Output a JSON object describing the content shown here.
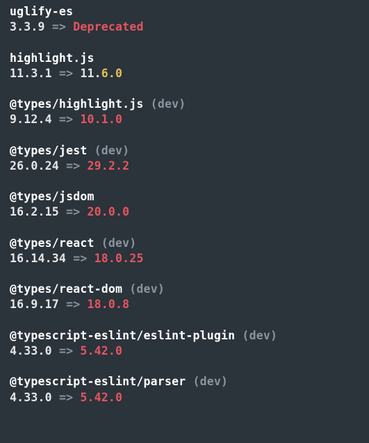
{
  "arrow": "=>",
  "dev_suffix": " (dev)",
  "packages": [
    {
      "name": "uglify-es",
      "dev": false,
      "current": "3.3.9",
      "deprecated": true
    },
    {
      "name": "highlight.js",
      "dev": false,
      "current": "11.3.1",
      "target_parts": [
        [
          "same",
          "11."
        ],
        [
          "minor",
          "6.0"
        ]
      ]
    },
    {
      "name": "@types/highlight.js",
      "dev": true,
      "current": "9.12.4",
      "target_parts": [
        [
          "major",
          "10.1.0"
        ]
      ]
    },
    {
      "name": "@types/jest",
      "dev": true,
      "current": "26.0.24",
      "target_parts": [
        [
          "major",
          "29.2.2"
        ]
      ]
    },
    {
      "name": "@types/jsdom",
      "dev": false,
      "current": "16.2.15",
      "target_parts": [
        [
          "major",
          "20.0.0"
        ]
      ]
    },
    {
      "name": "@types/react",
      "dev": true,
      "current": "16.14.34",
      "target_parts": [
        [
          "major",
          "18.0.25"
        ]
      ]
    },
    {
      "name": "@types/react-dom",
      "dev": true,
      "current": "16.9.17",
      "target_parts": [
        [
          "major",
          "18.0.8"
        ]
      ]
    },
    {
      "name": "@typescript-eslint/eslint-plugin",
      "dev": true,
      "current": "4.33.0",
      "target_parts": [
        [
          "major",
          "5.42.0"
        ]
      ]
    },
    {
      "name": "@typescript-eslint/parser",
      "dev": true,
      "current": "4.33.0",
      "target_parts": [
        [
          "major",
          "5.42.0"
        ]
      ]
    }
  ],
  "deprecated_label": "Deprecated"
}
